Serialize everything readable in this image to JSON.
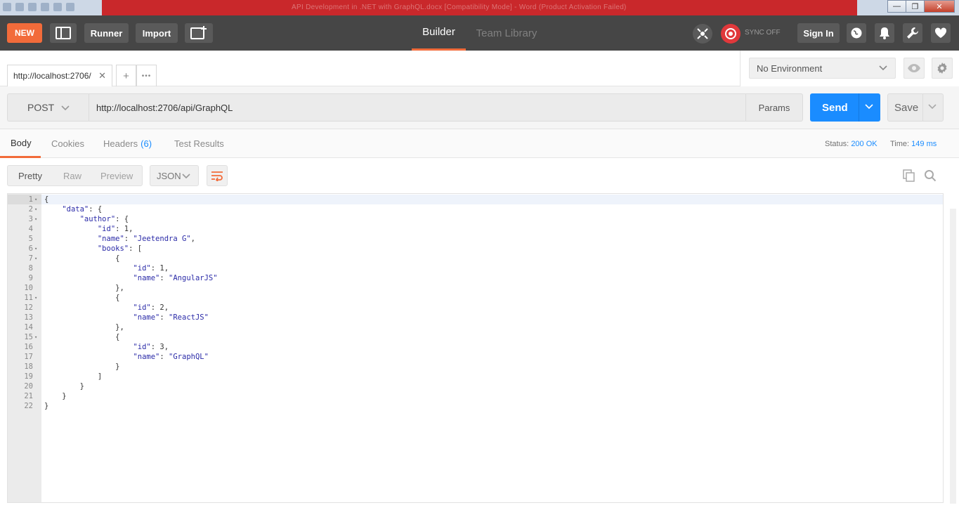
{
  "window": {
    "title_blurred": "API Development in .NET with GraphQL.docx [Compatibility Mode] - Word (Product Activation Failed)",
    "controls": [
      "minimize",
      "restore",
      "close"
    ]
  },
  "header": {
    "new_label": "NEW",
    "runner_label": "Runner",
    "import_label": "Import",
    "tabs": [
      {
        "label": "Builder",
        "active": true
      },
      {
        "label": "Team Library",
        "active": false
      }
    ],
    "sync_label": "SYNC OFF",
    "signin_label": "Sign In",
    "accent_color": "#f26b3a"
  },
  "request_tab": {
    "title": "http://localhost:2706/",
    "close": "✕",
    "add": "+",
    "more": "•••"
  },
  "environment": {
    "selected": "No Environment"
  },
  "request": {
    "method": "POST",
    "url": "http://localhost:2706/api/GraphQL",
    "params_label": "Params",
    "send_label": "Send",
    "save_label": "Save",
    "send_color": "#1a8cff"
  },
  "response": {
    "tabs": [
      {
        "label": "Body",
        "active": true
      },
      {
        "label": "Cookies",
        "active": false
      },
      {
        "label": "Headers",
        "count": "(6)",
        "active": false
      },
      {
        "label": "Test Results",
        "active": false
      }
    ],
    "status_label": "Status:",
    "status_value": "200 OK",
    "time_label": "Time:",
    "time_value": "149 ms",
    "formats": [
      {
        "label": "Pretty",
        "active": true
      },
      {
        "label": "Raw",
        "active": false
      },
      {
        "label": "Preview",
        "active": false
      }
    ],
    "language": "JSON"
  },
  "code_lines": [
    {
      "n": "1",
      "fold": true,
      "text": "{"
    },
    {
      "n": "2",
      "fold": true,
      "text": "    \"data\": {"
    },
    {
      "n": "3",
      "fold": true,
      "text": "        \"author\": {"
    },
    {
      "n": "4",
      "fold": false,
      "text": "            \"id\": 1,"
    },
    {
      "n": "5",
      "fold": false,
      "text": "            \"name\": \"Jeetendra G\","
    },
    {
      "n": "6",
      "fold": true,
      "text": "            \"books\": ["
    },
    {
      "n": "7",
      "fold": true,
      "text": "                {"
    },
    {
      "n": "8",
      "fold": false,
      "text": "                    \"id\": 1,"
    },
    {
      "n": "9",
      "fold": false,
      "text": "                    \"name\": \"AngularJS\""
    },
    {
      "n": "10",
      "fold": false,
      "text": "                },"
    },
    {
      "n": "11",
      "fold": true,
      "text": "                {"
    },
    {
      "n": "12",
      "fold": false,
      "text": "                    \"id\": 2,"
    },
    {
      "n": "13",
      "fold": false,
      "text": "                    \"name\": \"ReactJS\""
    },
    {
      "n": "14",
      "fold": false,
      "text": "                },"
    },
    {
      "n": "15",
      "fold": true,
      "text": "                {"
    },
    {
      "n": "16",
      "fold": false,
      "text": "                    \"id\": 3,"
    },
    {
      "n": "17",
      "fold": false,
      "text": "                    \"name\": \"GraphQL\""
    },
    {
      "n": "18",
      "fold": false,
      "text": "                }"
    },
    {
      "n": "19",
      "fold": false,
      "text": "            ]"
    },
    {
      "n": "20",
      "fold": false,
      "text": "        }"
    },
    {
      "n": "21",
      "fold": false,
      "text": "    }"
    },
    {
      "n": "22",
      "fold": false,
      "text": "}"
    }
  ]
}
